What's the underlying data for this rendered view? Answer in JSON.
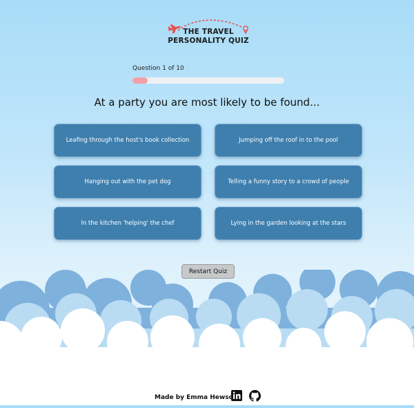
{
  "header": {
    "title_line1": "THE TRAVEL",
    "title_line2": "PERSONALITY QUIZ",
    "logo_icons": [
      "airplane-icon",
      "map-pin-icon"
    ]
  },
  "progress": {
    "label": "Question 1 of 10",
    "fraction": 0.1
  },
  "question": "At a party you are most likely to be found...",
  "answers": [
    "Leafing through the host's book collection",
    "Jumping off the roof in to the pool",
    "Hanging out with the pet dog",
    "Telling a funny story to a crowd of people",
    "In the kitchen 'helping' the chef",
    "Lying in the garden looking at the stars"
  ],
  "restart_label": "Restart Quiz",
  "footer": {
    "credit": "Made by Emma Hewson",
    "icons": [
      "linkedin-icon",
      "github-icon"
    ]
  },
  "colors": {
    "answer_bg": "#3e7fae",
    "progress_fill": "#f2a0a6",
    "logo_accent": "#e9514f",
    "sky_top": "#a8dcf8",
    "cloud_back": "#7fb1dd",
    "cloud_front": "#ffffff"
  }
}
